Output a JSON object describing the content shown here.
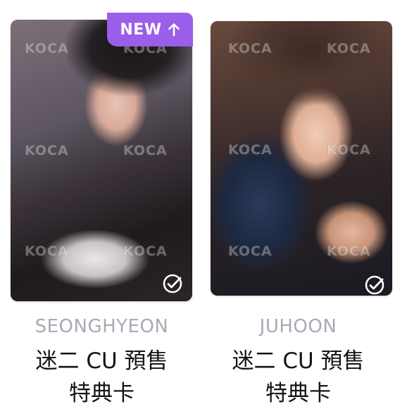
{
  "cards": [
    {
      "badge": {
        "label": "NEW",
        "icon": "arrow-up-icon",
        "color": "#9a5ee9"
      },
      "photo_alt": "Photocard of SEONGHYEON with lollipop",
      "watermark_text": "KOCA",
      "checked": true,
      "member": "SEONGHYEON",
      "title_line1": "迷二 CU 預售",
      "title_line2": "特典卡"
    },
    {
      "photo_alt": "Photocard of JUHOON with lollipop",
      "watermark_text": "KOCA",
      "checked": true,
      "member": "JUHOON",
      "title_line1": "迷二 CU 預售",
      "title_line2": "特典卡"
    }
  ],
  "colors": {
    "badge_purple": "#9a5ee9",
    "member_gray": "#a6abb3",
    "title_black": "#141414"
  }
}
